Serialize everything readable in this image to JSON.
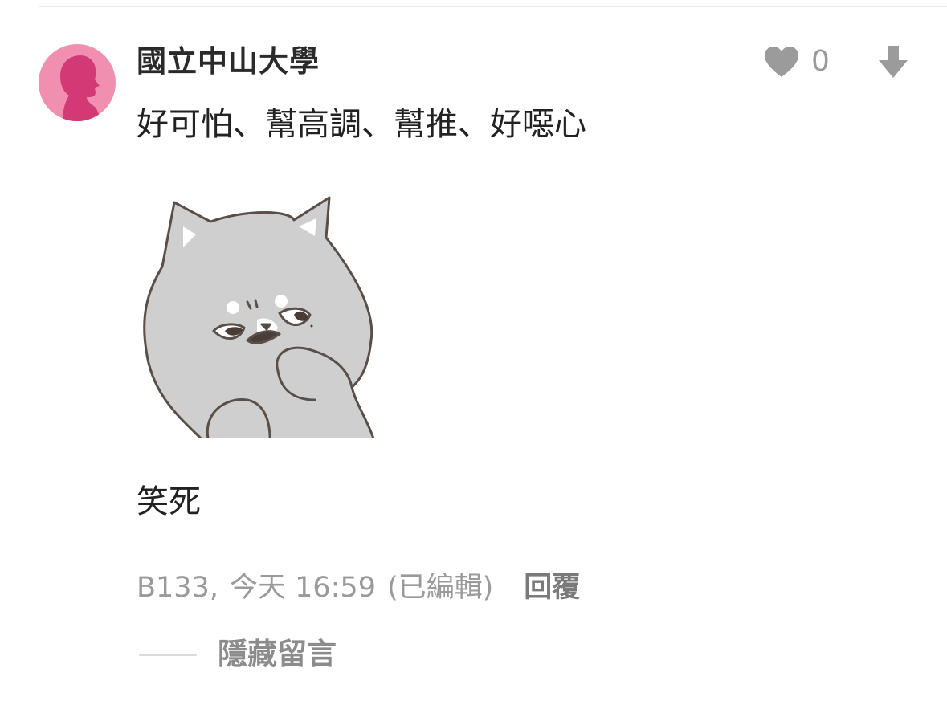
{
  "comment": {
    "author": "國立中山大學",
    "text_lines": [
      "好可怕、幫高調、幫推、好噁心",
      "笑死"
    ],
    "floor": "B133",
    "separator": ",",
    "time": "今天 16:59",
    "edited_label": "(已編輯)",
    "reply_label": "回覆",
    "like_count": "0",
    "hide_label": "隱藏留言",
    "sticker_icon": "gray-cat-sticker"
  },
  "colors": {
    "avatar_background": "#f18fb1",
    "avatar_silhouette": "#d33a75",
    "meta_text": "#9a9a9a",
    "icon_gray": "#9b9b9b"
  }
}
